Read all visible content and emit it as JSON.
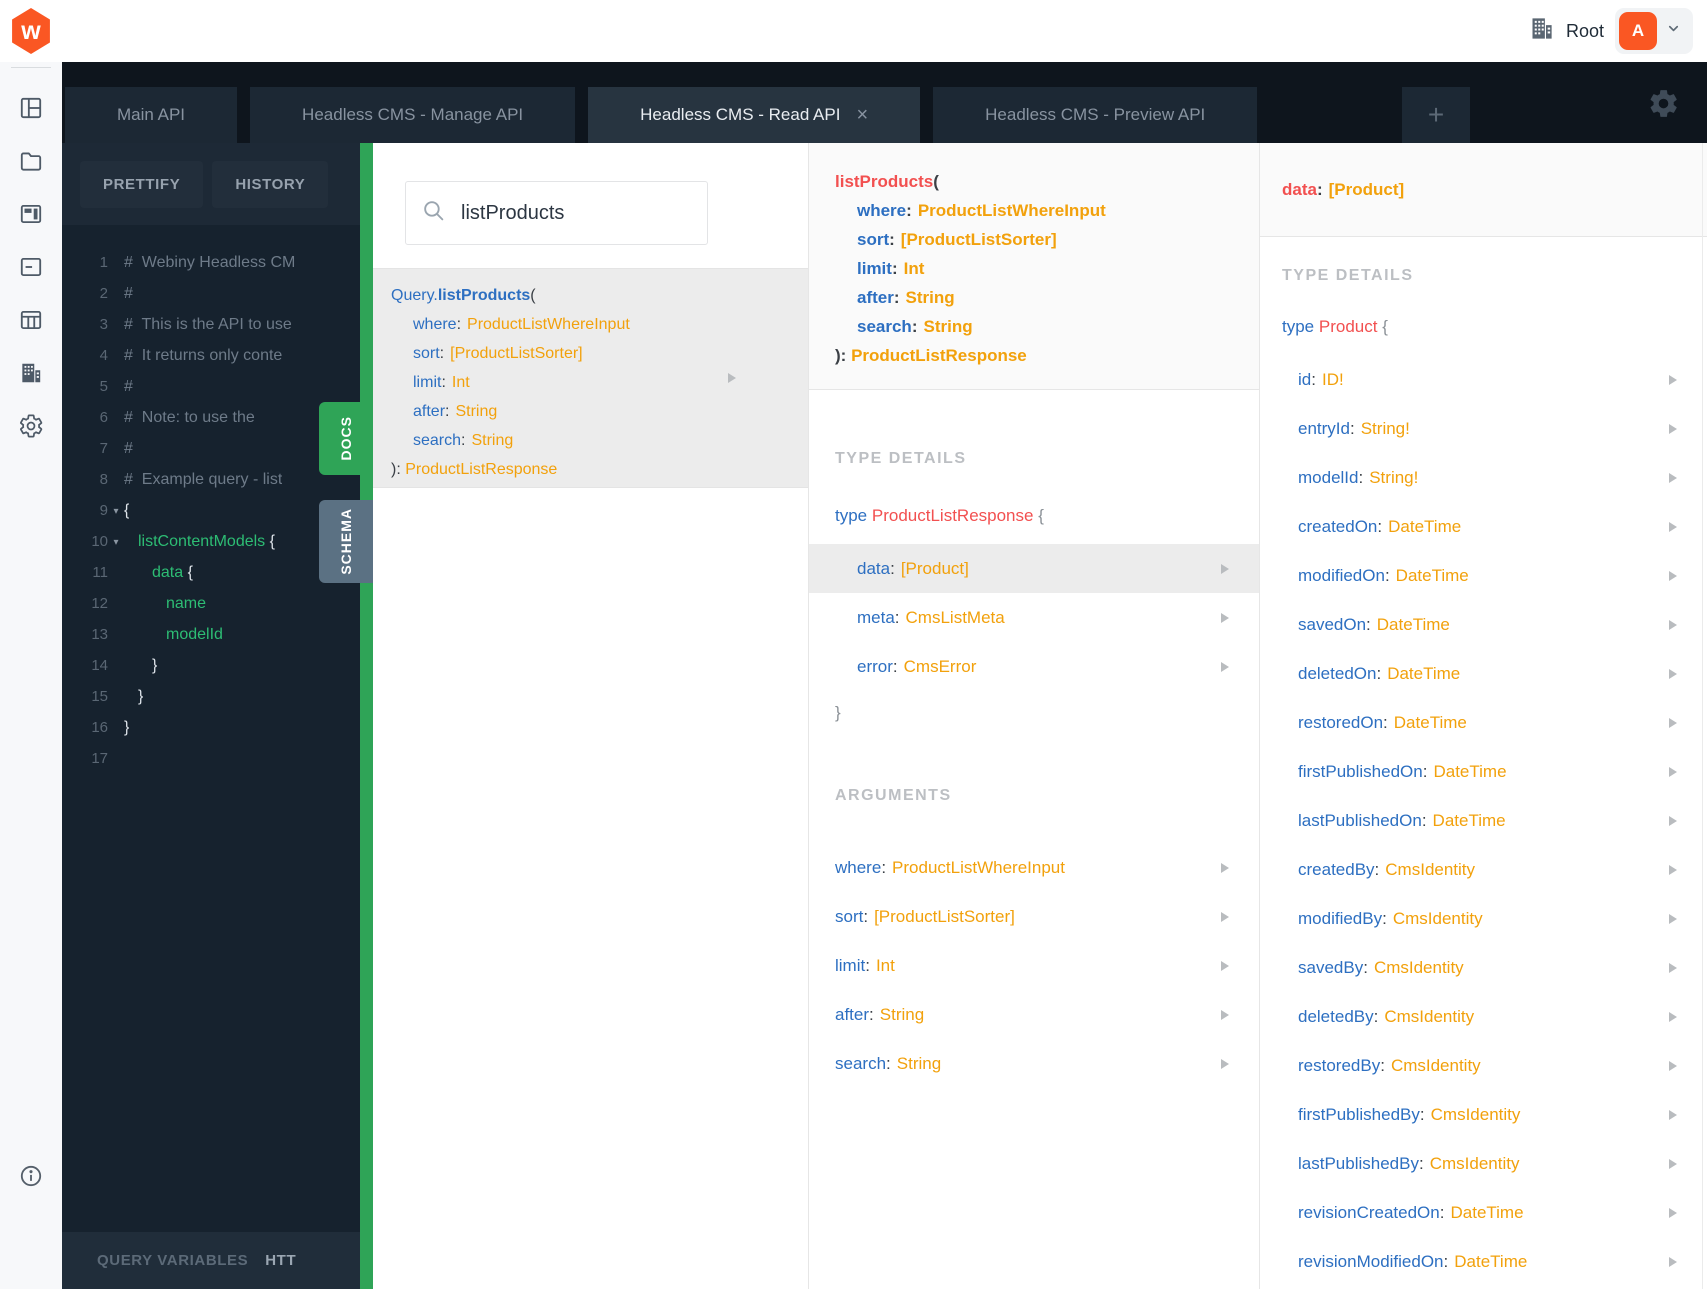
{
  "topbar": {
    "workspace_label": "Root",
    "avatar_letter": "A"
  },
  "tab_bar": {
    "tabs": [
      {
        "label": "Main API"
      },
      {
        "label": "Headless CMS - Manage API"
      },
      {
        "label": "Headless CMS - Read API",
        "active": true,
        "close": "×"
      },
      {
        "label": "Headless CMS - Preview API"
      }
    ],
    "add_label": "+"
  },
  "toolbar": {
    "prettify_label": "PRETTIFY",
    "history_label": "HISTORY"
  },
  "editor": {
    "lines": [
      {
        "n": "1",
        "segs": [
          [
            "c",
            "#  Webiny Headless CM"
          ]
        ]
      },
      {
        "n": "2",
        "segs": [
          [
            "c",
            "#"
          ]
        ]
      },
      {
        "n": "3",
        "segs": [
          [
            "c",
            "#  This is the API to use"
          ]
        ]
      },
      {
        "n": "4",
        "segs": [
          [
            "c",
            "#  It returns only conte"
          ]
        ]
      },
      {
        "n": "5",
        "segs": [
          [
            "c",
            "#"
          ]
        ]
      },
      {
        "n": "6",
        "segs": [
          [
            "c",
            "#  Note: to use the"
          ]
        ]
      },
      {
        "n": "7",
        "segs": [
          [
            "c",
            "#"
          ]
        ]
      },
      {
        "n": "8",
        "segs": [
          [
            "c",
            "#  Example query - list"
          ]
        ]
      },
      {
        "n": "9",
        "fold": true,
        "segs": [
          [
            "p",
            "{"
          ]
        ]
      },
      {
        "n": "10",
        "fold": true,
        "indent": 1,
        "segs": [
          [
            "g",
            "listContentModels"
          ],
          [
            "p",
            " {"
          ]
        ]
      },
      {
        "n": "11",
        "indent": 2,
        "segs": [
          [
            "g",
            "data"
          ],
          [
            "p",
            " {"
          ]
        ]
      },
      {
        "n": "12",
        "indent": 3,
        "segs": [
          [
            "g",
            "name"
          ]
        ]
      },
      {
        "n": "13",
        "indent": 3,
        "segs": [
          [
            "g",
            "modelId"
          ]
        ]
      },
      {
        "n": "14",
        "indent": 2,
        "segs": [
          [
            "p",
            "}"
          ]
        ]
      },
      {
        "n": "15",
        "indent": 1,
        "segs": [
          [
            "p",
            "}"
          ]
        ]
      },
      {
        "n": "16",
        "segs": [
          [
            "p",
            "}"
          ]
        ]
      },
      {
        "n": "17",
        "segs": []
      }
    ]
  },
  "bottom_bar": {
    "query_variables_label": "QUERY VARIABLES",
    "http_headers_label": "HTT"
  },
  "side_tabs": {
    "docs_label": "DOCS",
    "schema_label": "SCHEMA"
  },
  "doc_search": {
    "value": "listProducts"
  },
  "punct": {
    "colon": ":",
    "open_paren": "(",
    "close_paren_colon": "):",
    "open_brace": "{",
    "close_brace": "}"
  },
  "search_result": {
    "prefix": "Query.",
    "name": "listProducts",
    "args": [
      {
        "name": "where",
        "type": "ProductListWhereInput"
      },
      {
        "name": "sort",
        "type": "[ProductListSorter]"
      },
      {
        "name": "limit",
        "type": "Int"
      },
      {
        "name": "after",
        "type": "String"
      },
      {
        "name": "search",
        "type": "String"
      }
    ],
    "return_type": "ProductListResponse"
  },
  "field_doc": {
    "name": "listProducts",
    "args": [
      {
        "name": "where",
        "type": "ProductListWhereInput"
      },
      {
        "name": "sort",
        "type": "[ProductListSorter]"
      },
      {
        "name": "limit",
        "type": "Int"
      },
      {
        "name": "after",
        "type": "String"
      },
      {
        "name": "search",
        "type": "String"
      }
    ],
    "return_type": "ProductListResponse",
    "type_details_label": "TYPE DETAILS",
    "type_keyword": "type",
    "type_name": "ProductListResponse",
    "fields": [
      {
        "name": "data",
        "type": "[Product]",
        "selected": true
      },
      {
        "name": "meta",
        "type": "CmsListMeta"
      },
      {
        "name": "error",
        "type": "CmsError"
      }
    ],
    "arguments_label": "ARGUMENTS",
    "arguments": [
      {
        "name": "where",
        "type": "ProductListWhereInput"
      },
      {
        "name": "sort",
        "type": "[ProductListSorter]"
      },
      {
        "name": "limit",
        "type": "Int"
      },
      {
        "name": "after",
        "type": "String"
      },
      {
        "name": "search",
        "type": "String"
      }
    ]
  },
  "type_doc": {
    "field_name": "data",
    "field_type": "[Product]",
    "type_details_label": "TYPE DETAILS",
    "type_keyword": "type",
    "type_name": "Product",
    "fields": [
      {
        "name": "id",
        "type": "ID!"
      },
      {
        "name": "entryId",
        "type": "String!"
      },
      {
        "name": "modelId",
        "type": "String!"
      },
      {
        "name": "createdOn",
        "type": "DateTime"
      },
      {
        "name": "modifiedOn",
        "type": "DateTime"
      },
      {
        "name": "savedOn",
        "type": "DateTime"
      },
      {
        "name": "deletedOn",
        "type": "DateTime"
      },
      {
        "name": "restoredOn",
        "type": "DateTime"
      },
      {
        "name": "firstPublishedOn",
        "type": "DateTime"
      },
      {
        "name": "lastPublishedOn",
        "type": "DateTime"
      },
      {
        "name": "createdBy",
        "type": "CmsIdentity"
      },
      {
        "name": "modifiedBy",
        "type": "CmsIdentity"
      },
      {
        "name": "savedBy",
        "type": "CmsIdentity"
      },
      {
        "name": "deletedBy",
        "type": "CmsIdentity"
      },
      {
        "name": "restoredBy",
        "type": "CmsIdentity"
      },
      {
        "name": "firstPublishedBy",
        "type": "CmsIdentity"
      },
      {
        "name": "lastPublishedBy",
        "type": "CmsIdentity"
      },
      {
        "name": "revisionCreatedOn",
        "type": "DateTime"
      },
      {
        "name": "revisionModifiedOn",
        "type": "DateTime"
      }
    ]
  },
  "colors": {
    "brand_orange": "#fa5723",
    "accent_green": "#2fa457",
    "schema_slate": "#5b7183",
    "syntax_blue": "#2d6fc1",
    "syntax_orange": "#f2a10c",
    "syntax_red": "#f25050",
    "editor_green": "#2dbd74",
    "tabbar_bg": "#0e151d",
    "editor_bg": "#16222e"
  }
}
